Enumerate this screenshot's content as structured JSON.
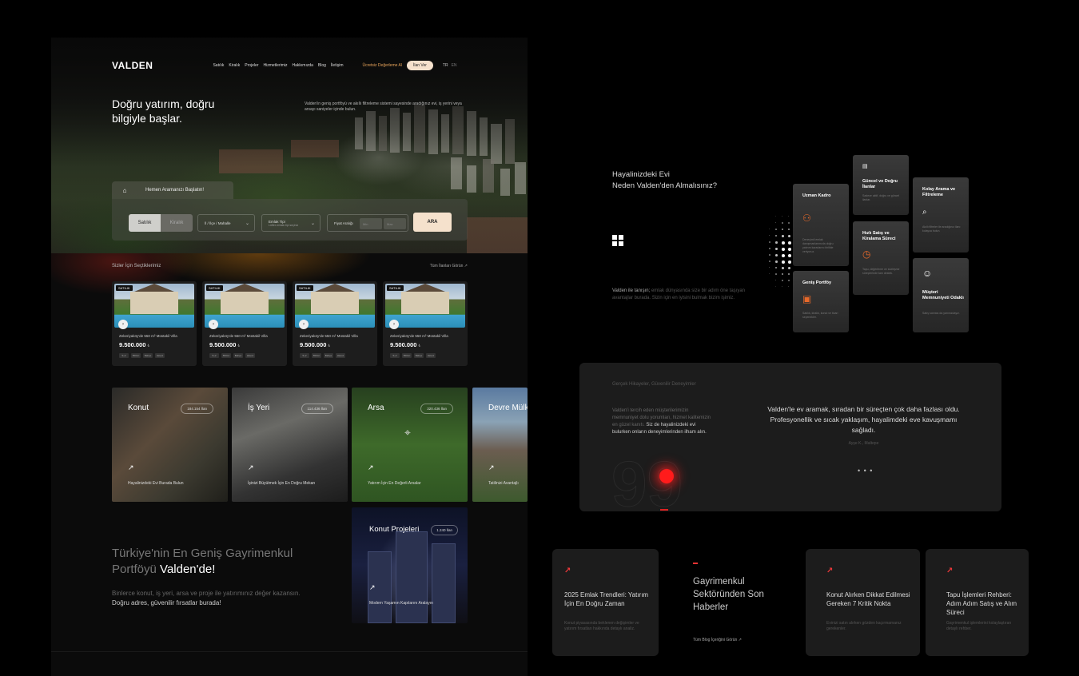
{
  "brand": {
    "logo": "VALDEN"
  },
  "nav": {
    "links": [
      "Satılık",
      "Kiralık",
      "Projeler",
      "Hizmetlerimiz",
      "Hakkımızda",
      "Blog",
      "İletişim"
    ],
    "cta_text": "Ücretsiz Değerleme Al",
    "cta_button": "İlan Ver",
    "lang_active": "TR",
    "lang_alt": "EN"
  },
  "hero": {
    "title": "Doğru yatırım, doğru bilgiyle başlar.",
    "subtitle": "Valden'in geniş portföyü ve akıllı filtreleme sistemi sayesinde aradığınız evi, iş yerini veya arsayı saniyeler içinde bulun."
  },
  "search": {
    "tab_label": "Hemen Aramanızı Başlatın!",
    "mode_sale": "Satılık",
    "mode_rent": "Kiralık",
    "location_placeholder": "İl / İlçe / Mahalle",
    "type_label": "Emlak Tipi",
    "type_placeholder": "Lütfen emlak tipi seçiniz",
    "price_label": "Fiyat Aralığı",
    "price_min": "Min",
    "price_max": "Max",
    "submit": "ARA"
  },
  "featured": {
    "heading": "Sizler İçin Seçtiklerimiz",
    "see_all": "Tüm İlanları Görün",
    "cards": [
      {
        "tag": "SATILIK",
        "title": "Zekeriyaköy'de 550 m² Müstakil Villa",
        "price": "9.500.000",
        "currency": "₺",
        "chips": [
          "5+2",
          "550m²",
          "Bahçe",
          "Havuz"
        ]
      },
      {
        "tag": "SATILIK",
        "title": "Zekeriyaköy'de 550 m² Müstakil Villa",
        "price": "9.500.000",
        "currency": "₺",
        "chips": [
          "5+2",
          "550m²",
          "Bahçe",
          "Havuz"
        ]
      },
      {
        "tag": "SATILIK",
        "title": "Zekeriyaköy'de 550 m² Müstakil Villa",
        "price": "9.500.000",
        "currency": "₺",
        "chips": [
          "5+2",
          "550m²",
          "Bahçe",
          "Havuz"
        ]
      },
      {
        "tag": "SATILIK",
        "title": "Zekeriyaköy'de 550 m² Müstakil Villa",
        "price": "9.500.000",
        "currency": "₺",
        "chips": [
          "5+2",
          "550m²",
          "Bahçe",
          "Havuz"
        ]
      }
    ]
  },
  "categories": [
    {
      "label": "Konut",
      "count": "184.154 İlan",
      "caption": "Hayalinizdeki Evi Burada Bulun"
    },
    {
      "label": "İş Yeri",
      "count": "114.436 İlan",
      "caption": "İşinizi Büyütmek İçin En Doğru Mekan"
    },
    {
      "label": "Arsa",
      "count": "320.436 İlan",
      "caption": "Yatırım İçin En Değerli Arsalar"
    },
    {
      "label": "Devre Mülk",
      "count": "",
      "caption": "Tatilinizi Avantajlı"
    }
  ],
  "project": {
    "label": "Konut Projeleri",
    "count": "1.240 İlan",
    "caption": "Modern Yaşamın Kapılarını Aralayın"
  },
  "portfolio": {
    "title_dim": "Türkiye'nin En Geniş Gayrimenkul Portföyü",
    "title_bright": "Valden'de!",
    "text_dim": "Binlerce konut, iş yeri, arsa ve proje ile yatırımınız değer kazansın.",
    "text_bright": "Doğru adres, güvenilir fırsatlar burada!"
  },
  "why": {
    "title_line1": "Hayalinizdeki Evi",
    "title_line2": "Neden Valden'den Almalısınız?",
    "text_bright": "Valden ile tanışın;",
    "text_dim": "emlak dünyasında size bir adım öne taşıyan avantajlar burada. Sizin için en iyisini bulmak bizim işimiz."
  },
  "features": [
    {
      "title": "Uzman Kadro",
      "desc": "Deneyimli emlak danışmanlarımızla doğru yatırım kararlarını birlikte veriyoruz.",
      "icon": "user-plus-icon"
    },
    {
      "title": "Geniş Portföy",
      "desc": "Satılık, kiralık, konut ve ticari seçenekler.",
      "icon": "portfolio-icon"
    },
    {
      "title": "Güncel ve Doğru İlanlar",
      "desc": "Sadece aktif, doğru ve güncel ilanlar.",
      "icon": "card-icon"
    },
    {
      "title": "Hızlı Satış ve Kiralama Süreci",
      "desc": "Tapu, değerleme ve sözleşme süreçlerinde tam destek.",
      "icon": "clock-icon"
    },
    {
      "title": "Kolay Arama ve Filtreleme",
      "desc": "Akıllı filtreler ile aradığınız ilanı kolayca bulun.",
      "icon": "search-icon"
    },
    {
      "title": "Müşteri Memnuniyeti Odaklı",
      "desc": "Satış sonrası da yanınızdayız.",
      "icon": "smile-icon"
    }
  ],
  "testimonials": {
    "heading": "Gerçek Hikayeler, Güvenilir Deneyimler",
    "left_dim": "Valden'i tercih eden müşterilerimizin memnuniyet dolu yorumları, hizmet kalitemizin en güzel kanıtı.",
    "left_bright": "Siz de hayalinizdeki evi bulurken onların deneyimlerinden ilham alın.",
    "quote": "Valden'le ev aramak, sıradan bir süreçten çok daha fazlası oldu. Profesyonellik ve sıcak yaklaşım, hayalimdeki eve kavuşmamı sağladı.",
    "author": "Ayşe K., Maltepe",
    "pager": "• • •",
    "big_number": "99"
  },
  "news": {
    "items": [
      {
        "title": "2025 Emlak Trendleri: Yatırım İçin En Doğru Zaman",
        "desc": "Konut piyasasında beklenen değişimler ve yatırım fırsatları hakkında detaylı analiz."
      },
      {
        "title": "Konut Alırken Dikkat Edilmesi Gereken 7 Kritik Nokta",
        "desc": "Evinizi satın alırken gözden kaçırmamanız gerekenler."
      },
      {
        "title": "Tapu İşlemleri Rehberi: Adım Adım Satış ve Alım Süreci",
        "desc": "Gayrimenkul işlemlerini kolaylaştıran detaylı rehber."
      }
    ],
    "heading": "Gayrimenkul Sektöründen Son Haberler",
    "all_link": "Tüm Blog İçeriğini Görün"
  },
  "colors": {
    "accent": "#f5e1cc",
    "orange": "#e8692a",
    "red": "#ff1b1b"
  }
}
